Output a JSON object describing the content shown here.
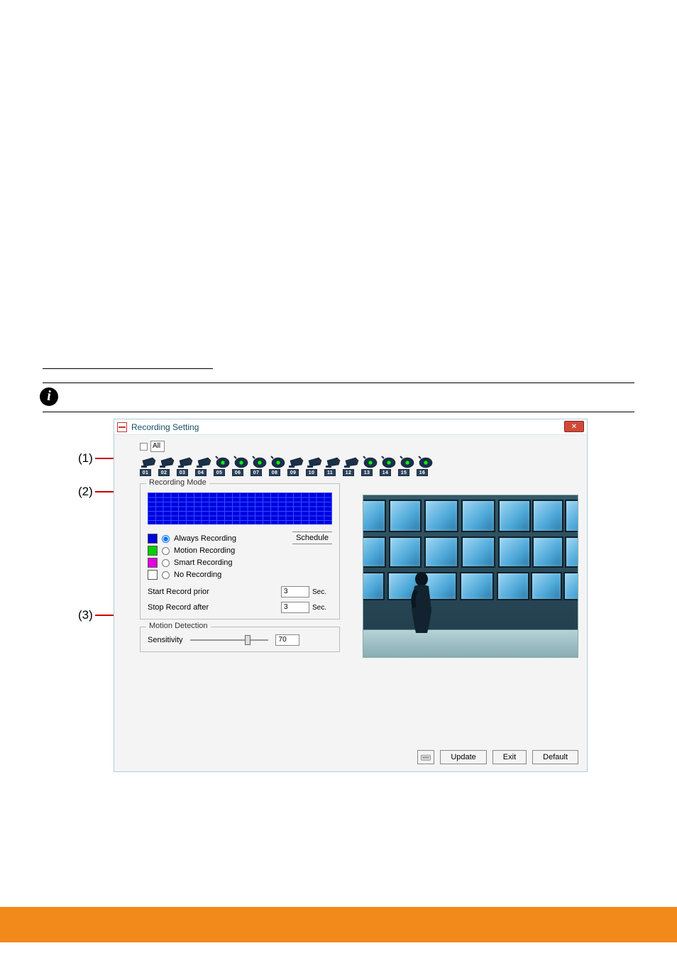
{
  "page": {
    "callouts": {
      "c1": "(1)",
      "c2": "(2)",
      "c3": "(3)"
    },
    "info_icon_glyph": "i"
  },
  "dialog": {
    "title": "Recording Setting",
    "close_glyph": "✕",
    "all_checkbox_label": "All",
    "cameras": [
      {
        "num": "01",
        "type": "analog"
      },
      {
        "num": "02",
        "type": "analog"
      },
      {
        "num": "03",
        "type": "analog"
      },
      {
        "num": "04",
        "type": "analog"
      },
      {
        "num": "05",
        "type": "digital"
      },
      {
        "num": "06",
        "type": "digital"
      },
      {
        "num": "07",
        "type": "digital"
      },
      {
        "num": "08",
        "type": "digital"
      },
      {
        "num": "09",
        "type": "analog"
      },
      {
        "num": "10",
        "type": "analog"
      },
      {
        "num": "11",
        "type": "analog"
      },
      {
        "num": "12",
        "type": "analog"
      },
      {
        "num": "13",
        "type": "digital"
      },
      {
        "num": "14",
        "type": "digital"
      },
      {
        "num": "15",
        "type": "digital"
      },
      {
        "num": "16",
        "type": "digital"
      }
    ],
    "recording_mode": {
      "legend": "Recording Mode",
      "options": {
        "always": {
          "label": "Always Recording",
          "color": "#0000e0",
          "checked": true
        },
        "motion": {
          "label": "Motion Recording",
          "color": "#00d000",
          "checked": false
        },
        "smart": {
          "label": "Smart Recording",
          "color": "#e000e0",
          "checked": false
        },
        "none": {
          "label": "No Recording",
          "color": "#ffffff",
          "checked": false
        }
      },
      "schedule_btn": "Schedule",
      "start_prior": {
        "label": "Start Record prior",
        "value": "3",
        "unit": "Sec."
      },
      "stop_after": {
        "label": "Stop Record after",
        "value": "3",
        "unit": "Sec."
      }
    },
    "motion_detection": {
      "legend": "Motion Detection",
      "sensitivity_label": "Sensitivity",
      "sensitivity_value": "70"
    },
    "footer": {
      "update": "Update",
      "exit": "Exit",
      "default": "Default"
    }
  }
}
